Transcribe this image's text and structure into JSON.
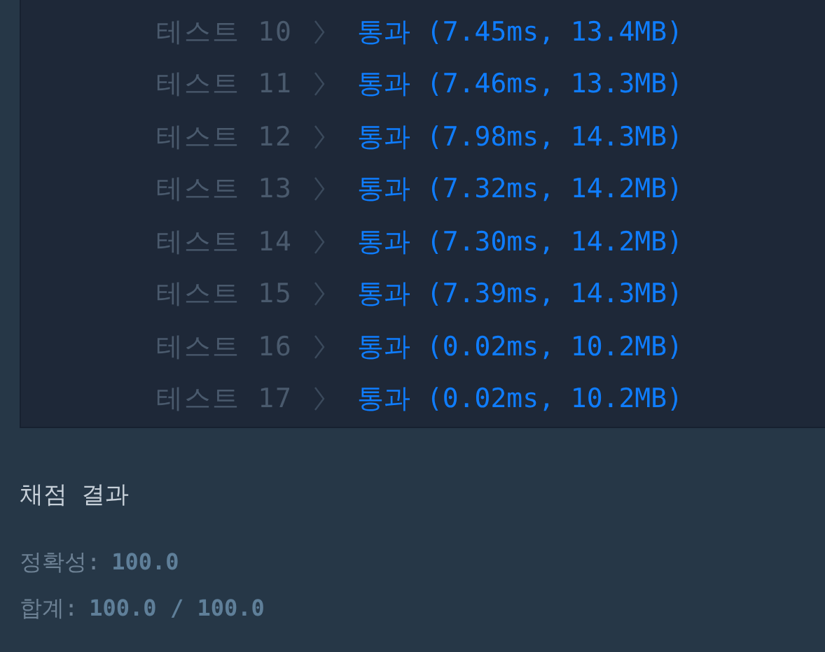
{
  "tests": [
    {
      "label": "테스트 10",
      "kind": "pass",
      "result": "통과 (7.45ms, 13.4MB)"
    },
    {
      "label": "테스트 11",
      "kind": "pass",
      "result": "통과 (7.46ms, 13.3MB)"
    },
    {
      "label": "테스트 12",
      "kind": "pass",
      "result": "통과 (7.98ms, 14.3MB)"
    },
    {
      "label": "테스트 13",
      "kind": "pass",
      "result": "통과 (7.32ms, 14.2MB)"
    },
    {
      "label": "테스트 14",
      "kind": "pass",
      "result": "통과 (7.30ms, 14.2MB)"
    },
    {
      "label": "테스트 15",
      "kind": "pass",
      "result": "통과 (7.39ms, 14.3MB)"
    },
    {
      "label": "테스트 16",
      "kind": "pass",
      "result": "통과 (0.02ms, 10.2MB)"
    },
    {
      "label": "테스트 17",
      "kind": "pass",
      "result": "통과 (0.02ms, 10.2MB)"
    }
  ],
  "summary": {
    "title": "채점 결과",
    "lines": [
      {
        "label": "정확성:",
        "value": "100.0"
      },
      {
        "label": "합계:",
        "value": "100.0 / 100.0"
      }
    ]
  }
}
